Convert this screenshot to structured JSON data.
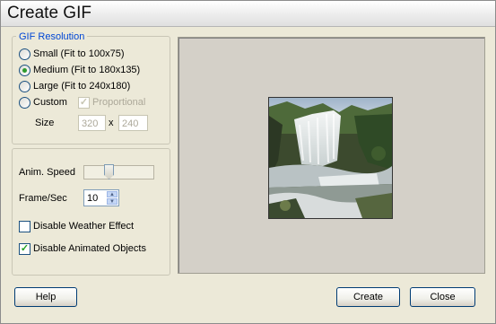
{
  "window": {
    "title": "Create GIF"
  },
  "resolution": {
    "legend": "GIF Resolution",
    "options": [
      {
        "label": "Small (Fit to 100x75)",
        "selected": false
      },
      {
        "label": "Medium (Fit to 180x135)",
        "selected": true
      },
      {
        "label": "Large (Fit to 240x180)",
        "selected": false
      },
      {
        "label": "Custom",
        "selected": false
      }
    ],
    "proportional_label": "Proportional",
    "proportional_checked": true,
    "size_label": "Size",
    "width": "320",
    "times": "x",
    "height": "240"
  },
  "controls": {
    "speed_label": "Anim. Speed",
    "speed_level_fraction": 0.33,
    "fps_label": "Frame/Sec",
    "fps_value": "10",
    "weather_label": "Disable Weather Effect",
    "weather_checked": false,
    "objects_label": "Disable Animated Objects",
    "objects_checked": true
  },
  "buttons": {
    "help": "Help",
    "create": "Create",
    "close": "Close"
  },
  "colors": {
    "legend": "#0046d5",
    "check": "#21a121",
    "radio_dot": "#2d9b2d",
    "face": "#ECE9D8"
  },
  "icons": {
    "preview": "waterfall-preview-image"
  }
}
